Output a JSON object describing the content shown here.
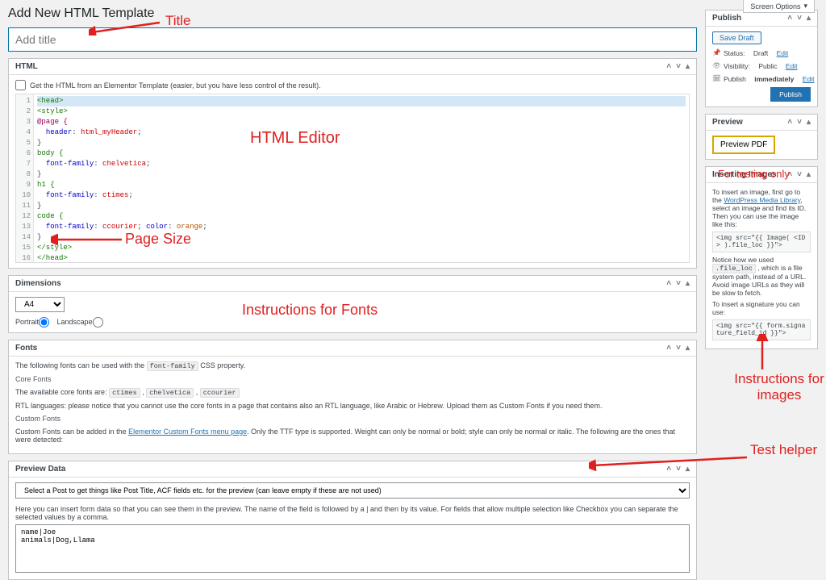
{
  "screen_options_label": "Screen Options",
  "page_title": "Add New HTML Template",
  "title_placeholder": "Add title",
  "html_box": {
    "title": "HTML",
    "checkbox_label": "Get the HTML from an Elementor Template (easier, but you have less control of the result).",
    "lines": {
      "l1": "<head>",
      "l2": "<style>",
      "l3": "@page {",
      "l4_prop": "header",
      "l4_val": "html_myHeader",
      "l5": "}",
      "l6": "body {",
      "l7_prop": "font-family",
      "l7_val": "chelvetica",
      "l8": "}",
      "l9": "h1 {",
      "l10_prop": "font-family",
      "l10_val": "ctimes",
      "l11": "}",
      "l12": "code {",
      "l13_prop": "font-family",
      "l13_val": "ccourier",
      "l13_prop2": "color",
      "l13_val2": "orange",
      "l14": "}",
      "l15": "</style>",
      "l16": "</head>"
    }
  },
  "dimensions": {
    "title": "Dimensions",
    "size": "A4",
    "portrait": "Portrait",
    "landscape": "Landscape"
  },
  "fonts": {
    "title": "Fonts",
    "intro_a": "The following fonts can be used with the ",
    "intro_code": "font-family",
    "intro_b": " CSS property.",
    "core_title": "Core Fonts",
    "core_a": "The available core fonts are: ",
    "f1": "ctimes",
    "f2": "chelvetica",
    "f3": "ccourier",
    "rtl": "RTL languages: please notice that you cannot use the core fonts in a page that contains also an RTL language, like Arabic or Hebrew. Upload them as Custom Fonts if you need them.",
    "custom_title": "Custom Fonts",
    "custom_a": "Custom Fonts can be added in the ",
    "custom_link": "Elementor Custom Fonts menu page",
    "custom_b": ". Only the TTF type is supported. Weight can only be normal or bold; style can only be normal or italic. The following are the ones that were detected:"
  },
  "preview_data": {
    "title": "Preview Data",
    "select_placeholder": "Select a Post to get things like Post Title, ACF fields etc. for the preview (can leave empty if these are not used)",
    "help": "Here you can insert form data so that you can see them in the preview. The name of the field is followed by a | and then by its value. For fields that allow multiple selection like Checkbox you can separate the selected values by a comma.",
    "textarea": "name|Joe\nanimals|Dog,Llama"
  },
  "publish": {
    "title": "Publish",
    "save_draft": "Save Draft",
    "status_label": "Status:",
    "status_val": "Draft",
    "status_edit": "Edit",
    "vis_label": "Visibility:",
    "vis_val": "Public",
    "vis_edit": "Edit",
    "pub_label": "Publish",
    "pub_val": "immediately",
    "pub_edit": "Edit",
    "publish_btn": "Publish"
  },
  "preview_side": {
    "title": "Preview",
    "btn": "Preview PDF"
  },
  "images": {
    "title": "Inserting Images",
    "p1_a": "To insert an image, first go to the ",
    "p1_link": "WordPress Media Library",
    "p1_b": ", select an image and find its ID. Then you can use the image like this:",
    "code1": "<img src=\"{{ Image( <ID> ).file_loc }}\">",
    "p2_a": "Notice how we used ",
    "p2_code": ".file_loc",
    "p2_b": " , which is a file system path, instead of a URL. Avoid image URLs as they will be slow to fetch.",
    "p3": "To insert a signature you can use:",
    "code2": "<img src=\"{{ form.signature_field_id }}\">"
  },
  "annotations": {
    "title": "Title",
    "html_editor": "HTML Editor",
    "page_size": "Page Size",
    "fonts": "Instructions for Fonts",
    "testing": "For testing only",
    "images": "Instructions for images",
    "test_helper": "Test helper"
  }
}
